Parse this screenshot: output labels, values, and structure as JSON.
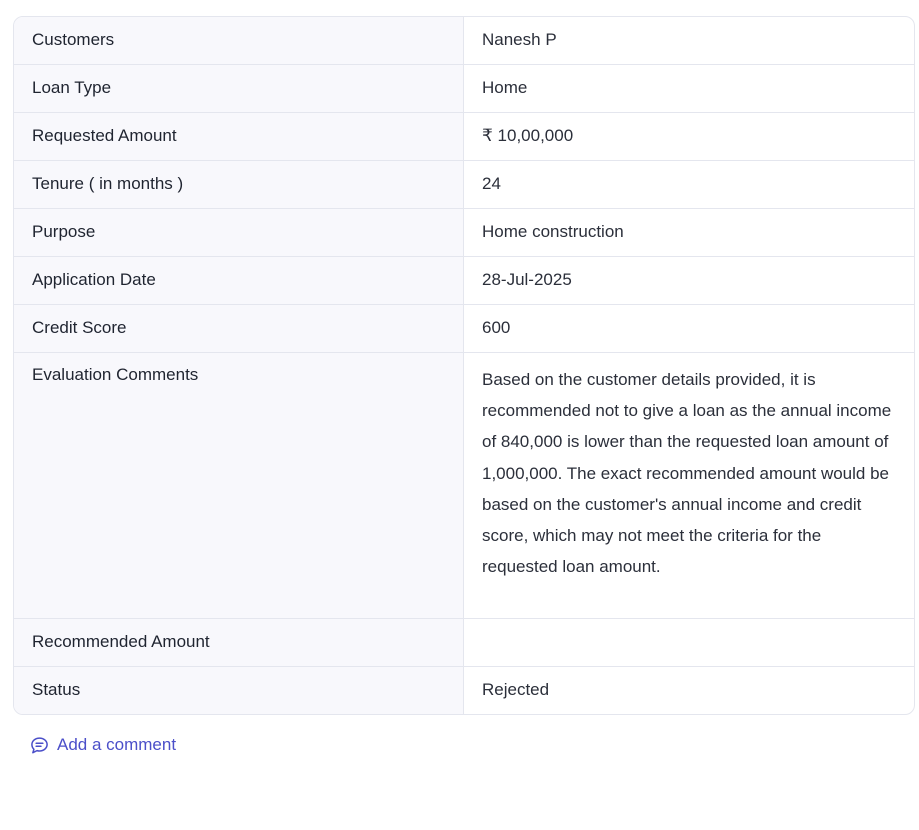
{
  "details": [
    {
      "label": "Customers",
      "value": "Nanesh P"
    },
    {
      "label": "Loan Type",
      "value": "Home"
    },
    {
      "label": "Requested Amount",
      "value": "₹ 10,00,000"
    },
    {
      "label": "Tenure ( in months )",
      "value": "24"
    },
    {
      "label": "Purpose",
      "value": "Home construction"
    },
    {
      "label": "Application Date",
      "value": "28-Jul-2025"
    },
    {
      "label": "Credit Score",
      "value": "600"
    },
    {
      "label": "Evaluation Comments",
      "value": "Based on the customer details provided, it is recommended not to give a loan as the annual income of 840,000 is lower than the requested loan amount of 1,000,000. The exact recommended amount would be based on the customer's annual income and credit score, which may not meet the criteria for the requested loan amount."
    },
    {
      "label": "Recommended Amount",
      "value": ""
    },
    {
      "label": "Status",
      "value": "Rejected"
    }
  ],
  "actions": {
    "add_comment_label": "Add a comment",
    "add_comment_icon": "comment-bubble-icon",
    "accent_color": "#4b4fc9"
  }
}
